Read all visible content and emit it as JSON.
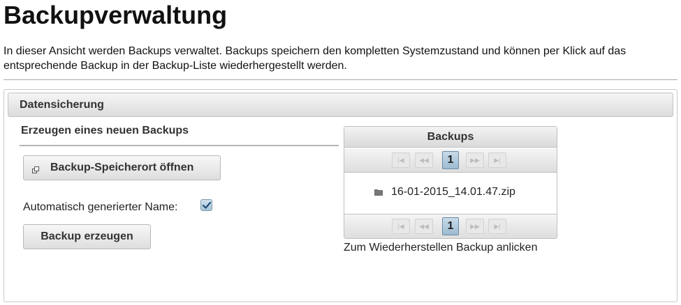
{
  "page": {
    "title": "Backupverwaltung",
    "intro": "In dieser Ansicht werden Backups verwaltet. Backups speichern den kompletten Systemzustand und können per Klick auf das entsprechende Backup in der Backup-Liste wiederhergestellt werden."
  },
  "panel": {
    "header": "Datensicherung",
    "create_section": {
      "title": "Erzeugen eines neuen Backups",
      "open_location_label": "Backup-Speicherort öffnen",
      "open_location_icon": "external-link-icon",
      "auto_name_label": "Automatisch generierter Name:",
      "auto_name_checked": true,
      "create_label": "Backup erzeugen"
    },
    "backups": {
      "title": "Backups",
      "current_page": "1",
      "pager_icons": [
        "first-page-icon",
        "prev-page-icon",
        "next-page-icon",
        "last-page-icon"
      ],
      "files": [
        {
          "name": "16-01-2015_14.01.47.zip",
          "icon": "folder-icon"
        }
      ],
      "hint": "Zum Wiederherstellen Backup anlicken"
    }
  },
  "colors": {
    "accent": "#9dbbd2",
    "header_gradient_top": "#f5f5f5",
    "header_gradient_bottom": "#dcdcdc"
  }
}
